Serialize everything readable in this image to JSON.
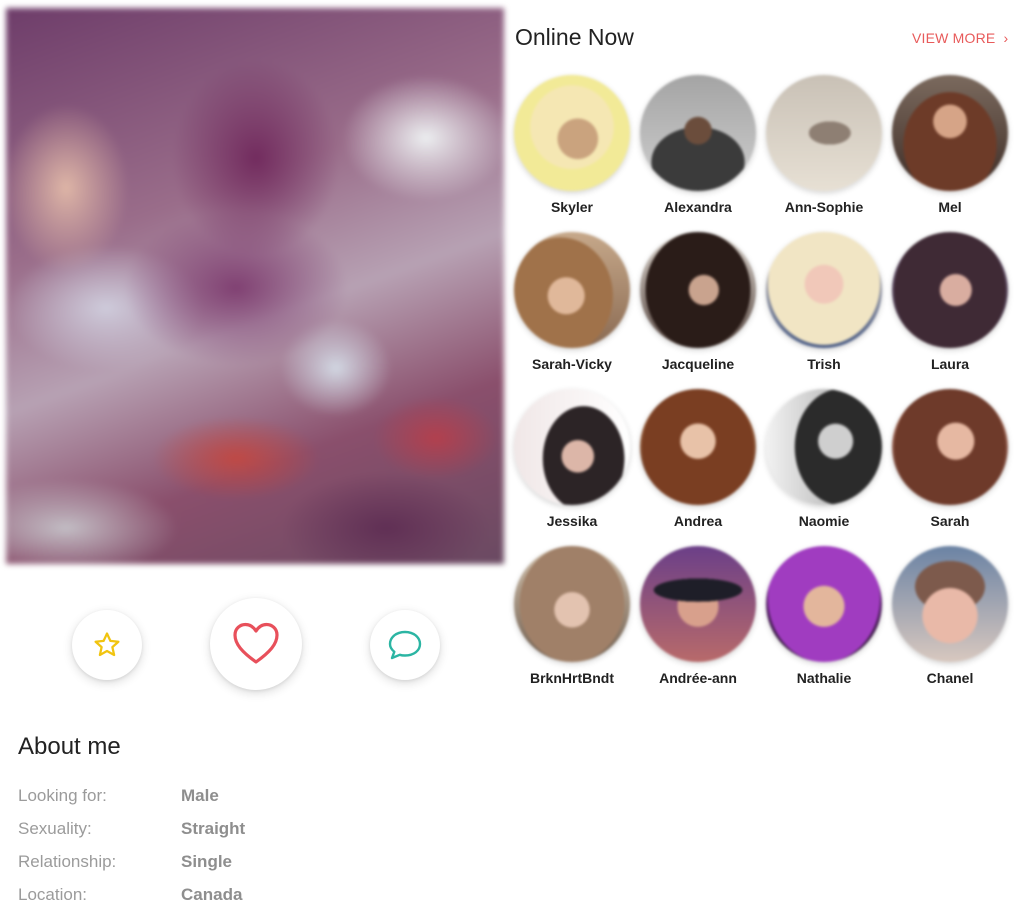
{
  "profile": {
    "photo_alt": "",
    "actions": {
      "favorite_icon": "star-icon",
      "like_icon": "heart-icon",
      "message_icon": "chat-bubble-icon",
      "colors": {
        "star": "#f1c40f",
        "heart": "#e8505b",
        "chat": "#2bb5a3"
      }
    }
  },
  "about": {
    "title": "About me",
    "rows": [
      {
        "label": "Looking for:",
        "value": "Male"
      },
      {
        "label": "Sexuality:",
        "value": "Straight"
      },
      {
        "label": "Relationship:",
        "value": "Single"
      },
      {
        "label": "Location:",
        "value": "Canada"
      }
    ]
  },
  "online": {
    "title": "Online Now",
    "view_more": "VIEW MORE",
    "view_more_color": "#e85a5a",
    "members": [
      {
        "name": "Skyler"
      },
      {
        "name": "Alexandra"
      },
      {
        "name": "Ann-Sophie"
      },
      {
        "name": "Mel"
      },
      {
        "name": "Sarah-Vicky"
      },
      {
        "name": "Jacqueline"
      },
      {
        "name": "Trish"
      },
      {
        "name": "Laura"
      },
      {
        "name": "Jessika"
      },
      {
        "name": "Andrea"
      },
      {
        "name": "Naomie"
      },
      {
        "name": "Sarah"
      },
      {
        "name": "BrknHrtBndt"
      },
      {
        "name": "Andrée-ann"
      },
      {
        "name": "Nathalie"
      },
      {
        "name": "Chanel"
      }
    ]
  }
}
